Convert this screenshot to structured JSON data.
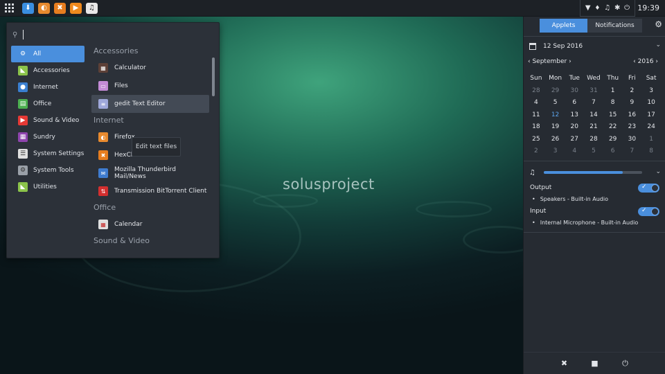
{
  "wallpaper": {
    "logo_text": "solusproject"
  },
  "panel": {
    "launchers": [
      {
        "icon": "download-icon",
        "glyph": "⬇",
        "color": "#3a8ee0"
      },
      {
        "icon": "firefox-icon",
        "glyph": "◐",
        "color": "#e88a2e"
      },
      {
        "icon": "hexchat-icon",
        "glyph": "✖",
        "color": "#e77d1f"
      },
      {
        "icon": "media-player-icon",
        "glyph": "▶",
        "color": "#f08a1e"
      },
      {
        "icon": "music-icon",
        "glyph": "♫",
        "color": "#e8e8e8"
      }
    ],
    "tray": {
      "wifi": "▼",
      "bell": "🔔",
      "volume": "🔊",
      "bluetooth": "✱",
      "power": "⏻"
    },
    "clock": "19:39"
  },
  "menu": {
    "search_placeholder": "",
    "categories": [
      {
        "label": "All",
        "icon": "gear-icon",
        "glyph": "⚙",
        "color": "#4a8fdd",
        "active": true
      },
      {
        "label": "Accessories",
        "icon": "accessories-icon",
        "glyph": "◣",
        "color": "#8bc34a"
      },
      {
        "label": "Internet",
        "icon": "internet-icon",
        "glyph": "●",
        "color": "#3a7fd0"
      },
      {
        "label": "Office",
        "icon": "office-icon",
        "glyph": "▤",
        "color": "#4caf50"
      },
      {
        "label": "Sound & Video",
        "icon": "sound-video-icon",
        "glyph": "▶",
        "color": "#e53935"
      },
      {
        "label": "Sundry",
        "icon": "sundry-icon",
        "glyph": "▦",
        "color": "#8e44ad"
      },
      {
        "label": "System Settings",
        "icon": "system-settings-icon",
        "glyph": "☰",
        "color": "#e0e0e0"
      },
      {
        "label": "System Tools",
        "icon": "system-tools-icon",
        "glyph": "⚙",
        "color": "#9aa0a8"
      },
      {
        "label": "Utilities",
        "icon": "utilities-icon",
        "glyph": "◣",
        "color": "#8bc34a"
      }
    ],
    "sections": [
      {
        "title": "Accessories",
        "apps": [
          {
            "label": "Calculator",
            "icon": "calculator-icon",
            "glyph": "▦",
            "color": "#5d4037"
          },
          {
            "label": "Files",
            "icon": "files-icon",
            "glyph": "▭",
            "color": "#c48bd6"
          },
          {
            "label": "gedit Text Editor",
            "icon": "gedit-icon",
            "glyph": "≡",
            "color": "#9fa8da",
            "hover": true
          }
        ]
      },
      {
        "title": "Internet",
        "apps": [
          {
            "label": "Firefox",
            "icon": "firefox-icon",
            "glyph": "◐",
            "color": "#e88a2e"
          },
          {
            "label": "HexChat",
            "icon": "hexchat-icon",
            "glyph": "✖",
            "color": "#e77d1f"
          },
          {
            "label": "Mozilla Thunderbird Mail/News",
            "icon": "thunderbird-icon",
            "glyph": "✉",
            "color": "#3f7ccf"
          },
          {
            "label": "Transmission BitTorrent Client",
            "icon": "transmission-icon",
            "glyph": "⇅",
            "color": "#d32f2f"
          }
        ]
      },
      {
        "title": "Office",
        "apps": [
          {
            "label": "Calendar",
            "icon": "calendar-icon",
            "glyph": "▦",
            "color": "#e0e0e0"
          }
        ]
      },
      {
        "title": "Sound & Video",
        "apps": []
      }
    ],
    "tooltip": "Edit text files"
  },
  "raven": {
    "tabs": {
      "applets": "Applets",
      "notifications": "Notifications"
    },
    "date_text": "12 Sep 2016",
    "calendar": {
      "month": "September",
      "year": "2016",
      "weekdays": [
        "Sun",
        "Mon",
        "Tue",
        "Wed",
        "Thu",
        "Fri",
        "Sat"
      ],
      "weeks": [
        [
          "28",
          "29",
          "30",
          "31",
          "1",
          "2",
          "3"
        ],
        [
          "4",
          "5",
          "6",
          "7",
          "8",
          "9",
          "10"
        ],
        [
          "11",
          "12",
          "13",
          "14",
          "15",
          "16",
          "17"
        ],
        [
          "18",
          "19",
          "20",
          "21",
          "22",
          "23",
          "24"
        ],
        [
          "25",
          "26",
          "27",
          "28",
          "29",
          "30",
          "1"
        ],
        [
          "2",
          "3",
          "4",
          "5",
          "6",
          "7",
          "8"
        ]
      ],
      "today": "12"
    },
    "volume_level": 0.8,
    "output": {
      "label": "Output",
      "device": "Speakers - Built-in Audio",
      "enabled": true
    },
    "input": {
      "label": "Input",
      "device": "Internal Microphone - Built-in Audio",
      "enabled": true
    }
  }
}
